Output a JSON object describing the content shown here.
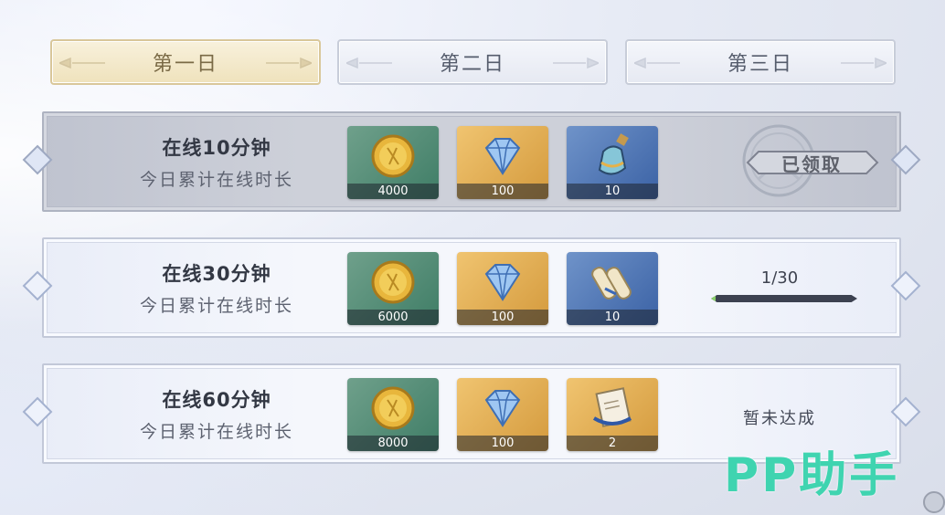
{
  "tabs": [
    {
      "label": "第一日",
      "active": true
    },
    {
      "label": "第二日",
      "active": false
    },
    {
      "label": "第三日",
      "active": false
    }
  ],
  "tasks": [
    {
      "title": "在线10分钟",
      "subtitle": "今日累计在线时长",
      "rewards": [
        {
          "icon": "gold-coin-icon",
          "count": "4000"
        },
        {
          "icon": "diamond-icon",
          "count": "100"
        },
        {
          "icon": "potion-bottle-icon",
          "count": "10"
        }
      ],
      "status": "claimed",
      "status_text": "已领取"
    },
    {
      "title": "在线30分钟",
      "subtitle": "今日累计在线时长",
      "rewards": [
        {
          "icon": "gold-coin-icon",
          "count": "6000"
        },
        {
          "icon": "diamond-icon",
          "count": "100"
        },
        {
          "icon": "scroll-icon",
          "count": "10"
        }
      ],
      "status": "in-progress",
      "status_text": "1/30",
      "progress": 0.033
    },
    {
      "title": "在线60分钟",
      "subtitle": "今日累计在线时长",
      "rewards": [
        {
          "icon": "gold-coin-icon",
          "count": "8000"
        },
        {
          "icon": "diamond-icon",
          "count": "100"
        },
        {
          "icon": "ticket-book-icon",
          "count": "2"
        }
      ],
      "status": "not-reached",
      "status_text": "暂未达成"
    }
  ],
  "watermark": "PP助手",
  "colors": {
    "active_tab": "#efe2bc",
    "reward_green": "#3f7d66",
    "reward_gold": "#d49a3d",
    "reward_blue": "#3b62a5",
    "progress_fill": "#8ad06a",
    "watermark": "#3fd4b0"
  }
}
